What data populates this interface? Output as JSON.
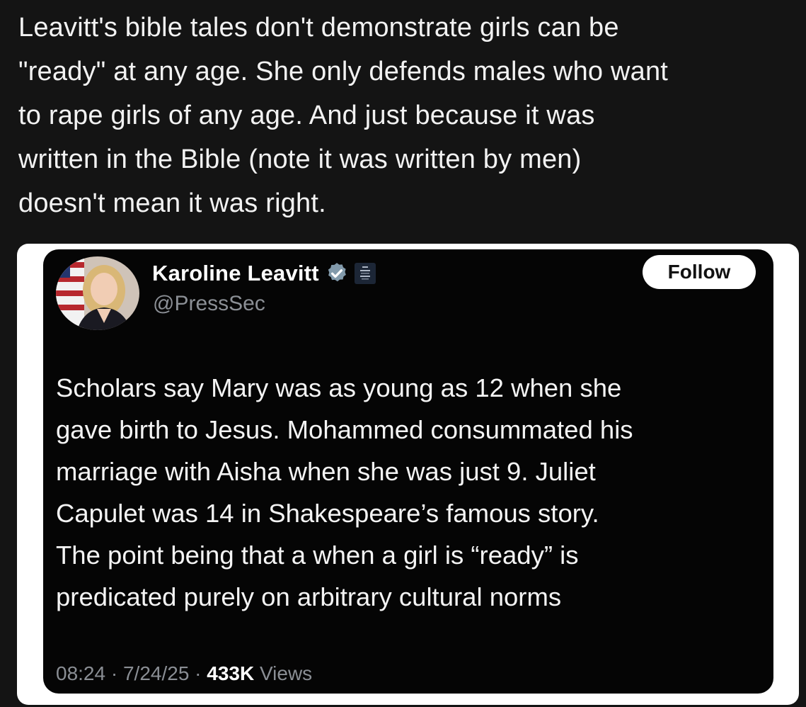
{
  "post": {
    "text": "Leavitt's bible tales don't demonstrate girls can be\n\"ready\" at any age. She only defends males who want\nto rape girls of any age. And just because it was\nwritten in the Bible (note it was written by men)\ndoesn't mean it was right."
  },
  "tweet": {
    "author_name": "Karoline Leavitt",
    "handle": "@PressSec",
    "follow_label": "Follow",
    "body": "Scholars say Mary was as young as 12 when she\ngave birth to Jesus. Mohammed consummated his\nmarriage with Aisha when she was just 9. Juliet\nCapulet was 14 in Shakespeare’s famous story.\nThe point being that a when a girl is “ready” is\npredicated purely on arbitrary cultural norms",
    "time": "08:24",
    "separator": "·",
    "date": "7/24/25",
    "views_count": "433K",
    "views_label": "Views",
    "verified_badge_color": "#829aab",
    "icons": [
      "verified-badge-icon",
      "white-house-seal-icon"
    ]
  },
  "colors": {
    "background": "#141414",
    "tweet_background": "#050505",
    "text_primary": "#f2f2f2",
    "text_secondary": "#8b8f95"
  }
}
